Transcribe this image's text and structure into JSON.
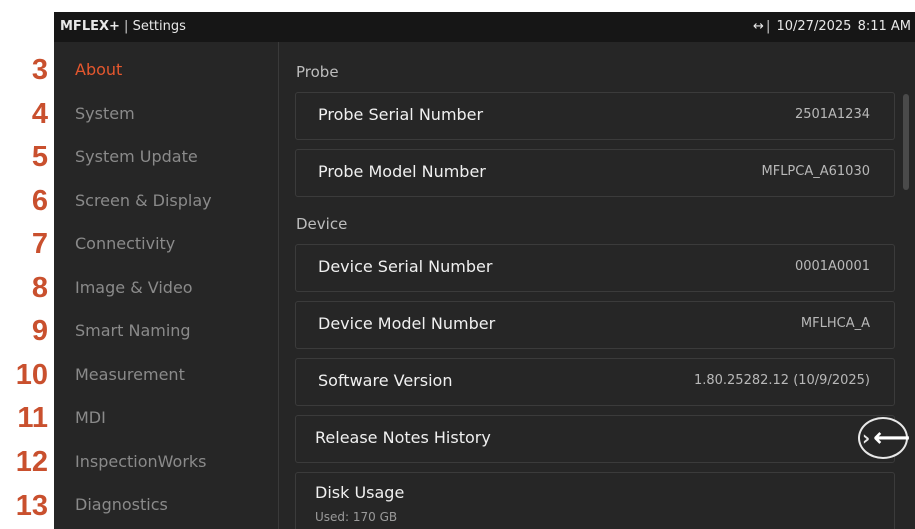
{
  "callouts": [
    "3",
    "4",
    "5",
    "6",
    "7",
    "8",
    "9",
    "10",
    "11",
    "12",
    "13"
  ],
  "statusbar": {
    "brand": "MFLEX+",
    "separator": "|",
    "title": "Settings",
    "connection_icon": "↔",
    "date": "10/27/2025",
    "time": "8:11 AM"
  },
  "sidebar": {
    "items": [
      {
        "label": "About"
      },
      {
        "label": "System"
      },
      {
        "label": "System Update"
      },
      {
        "label": "Screen & Display"
      },
      {
        "label": "Connectivity"
      },
      {
        "label": "Image & Video"
      },
      {
        "label": "Smart Naming"
      },
      {
        "label": "Measurement"
      },
      {
        "label": "MDI"
      },
      {
        "label": "InspectionWorks"
      },
      {
        "label": "Diagnostics"
      }
    ],
    "active_color": "#e4572e"
  },
  "content": {
    "probe_section": "Probe",
    "device_section": "Device",
    "rows": [
      {
        "label": "Probe Serial Number",
        "value": "2501A1234"
      },
      {
        "label": "Probe Model Number",
        "value": "MFLPCA_A61030"
      },
      {
        "label": "Device Serial Number",
        "value": "0001A0001"
      },
      {
        "label": "Device Model Number",
        "value": "MFLHCA_A"
      },
      {
        "label": "Software Version",
        "value": "1.80.25282.12 (10/9/2025)"
      }
    ],
    "release_notes": "Release Notes History",
    "disk_usage": "Disk Usage",
    "disk_used": "Used: 170 GB"
  },
  "back_button": {
    "icon": "back-arrow-icon",
    "chevron": "›",
    "arrow": "⟵"
  }
}
